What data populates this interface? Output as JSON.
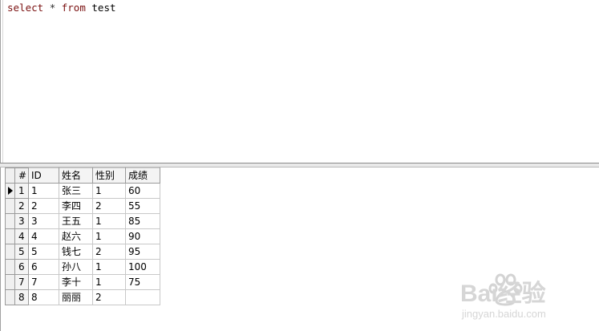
{
  "editor": {
    "sql": {
      "kw_select": "select",
      "star": "*",
      "kw_from": "from",
      "table": "test"
    }
  },
  "results": {
    "columns": [
      "#",
      "ID",
      "姓名",
      "性别",
      "成绩"
    ],
    "current_row": 1,
    "rows": [
      {
        "n": "1",
        "id": "1",
        "name": "张三",
        "sex": "1",
        "score": "60"
      },
      {
        "n": "2",
        "id": "2",
        "name": "李四",
        "sex": "2",
        "score": "55"
      },
      {
        "n": "3",
        "id": "3",
        "name": "王五",
        "sex": "1",
        "score": "85"
      },
      {
        "n": "4",
        "id": "4",
        "name": "赵六",
        "sex": "1",
        "score": "90"
      },
      {
        "n": "5",
        "id": "5",
        "name": "钱七",
        "sex": "2",
        "score": "95"
      },
      {
        "n": "6",
        "id": "6",
        "name": "孙八",
        "sex": "1",
        "score": "100"
      },
      {
        "n": "7",
        "id": "7",
        "name": "李十",
        "sex": "1",
        "score": "75"
      },
      {
        "n": "8",
        "id": "8",
        "name": "丽丽",
        "sex": "2",
        "score": ""
      }
    ]
  },
  "watermark": {
    "brand": "Bai经验",
    "url": "jingyan.baidu.com"
  },
  "colors": {
    "keyword": "#7a1010",
    "grid_line": "#c8c8c8",
    "header_bg": "#f4f4f4"
  }
}
